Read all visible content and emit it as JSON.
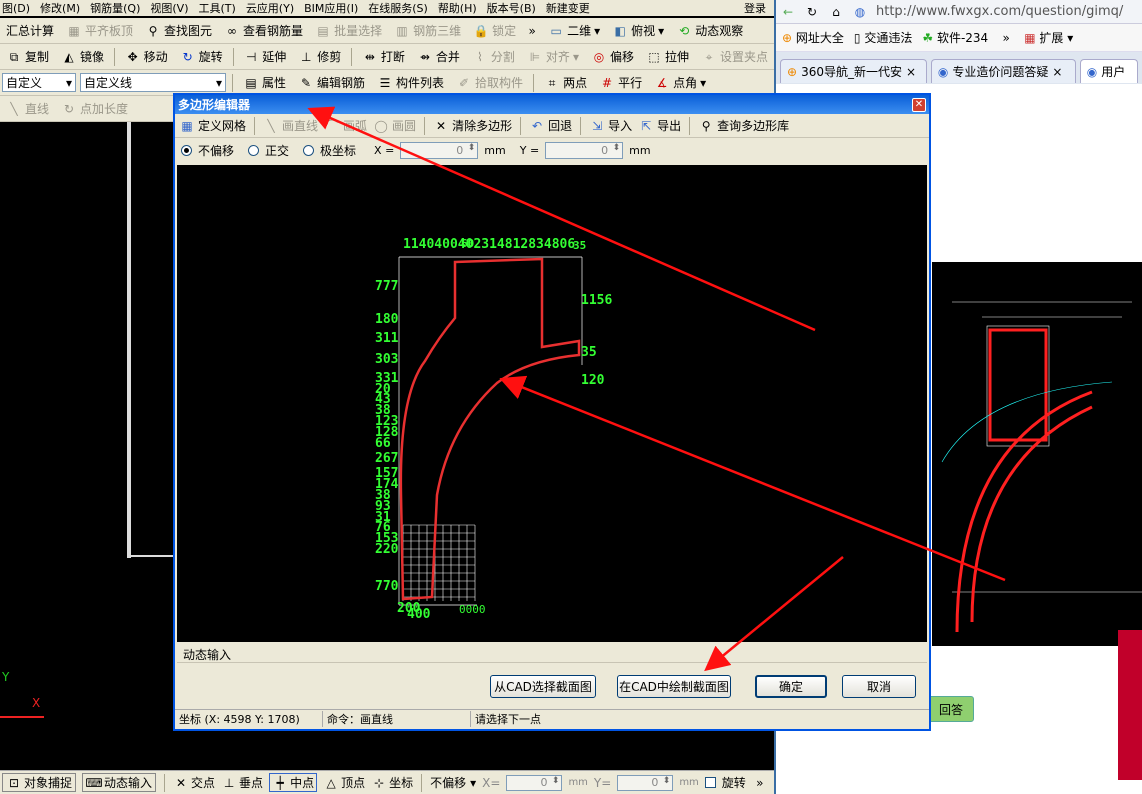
{
  "main_menu": [
    "图(D)",
    "修改(M)",
    "钢筋量(Q)",
    "视图(V)",
    "工具(T)",
    "云应用(Y)",
    "BIM应用(I)",
    "在线服务(S)",
    "帮助(H)",
    "版本号(B)",
    "新建变更"
  ],
  "login": "登录",
  "toolbar1": {
    "items": [
      "汇总计算",
      "平齐板顶",
      "查找图元",
      "查看钢筋量",
      "批量选择",
      "钢筋三维",
      "锁定"
    ],
    "view2d": "二维",
    "view_top": "俯视",
    "dynamic_observe": "动态观察"
  },
  "toolbar2": [
    "复制",
    "镜像",
    "移动",
    "旋转",
    "延伸",
    "修剪",
    "打断",
    "合并",
    "分割",
    "对齐",
    "偏移",
    "拉伸",
    "设置夹点"
  ],
  "toolbar3": {
    "combo1": "自定义",
    "combo2": "自定义线",
    "items": [
      "属性",
      "编辑钢筋",
      "构件列表",
      "拾取构件",
      "两点",
      "平行",
      "点角"
    ]
  },
  "toolbar4": [
    "直线",
    "点加长度"
  ],
  "browser": {
    "url": "http://www.fwxgx.com/question/gimq/",
    "bookmarks": [
      "网址大全",
      "交通违法",
      "软件-234",
      "扩展"
    ],
    "tabs": [
      "360导航_新一代安",
      "专业造价问题答疑",
      "用户"
    ],
    "answer_btn": "回答"
  },
  "dialog": {
    "title": "多边形编辑器",
    "tools": [
      "定义网格",
      "画直线",
      "画弧",
      "画圆",
      "清除多边形",
      "回退",
      "导入",
      "导出",
      "查询多边形库"
    ],
    "radio": [
      "不偏移",
      "正交",
      "极坐标"
    ],
    "x_label": "X =",
    "y_label": "Y =",
    "x_value": "0",
    "y_value": "0",
    "unit": "mm",
    "dynamic_input": "动态输入",
    "btn_select_cad": "从CAD选择截面图",
    "btn_draw_cad": "在CAD中绘制截面图",
    "btn_ok": "确定",
    "btn_cancel": "取消",
    "status_coord": "坐标 (X: 4598 Y: 1708)",
    "status_cmd": "命令：画直线",
    "status_prompt": "请选择下一点",
    "dims_top": "1140400402314812834806",
    "dims_top2": "60",
    "dims_top3": "35",
    "dim_right1": "1156",
    "dim_right2": "35",
    "dim_right3": "120",
    "dims_left": [
      "777",
      "180",
      "311",
      "303",
      "331",
      "20",
      "43",
      "38",
      "123",
      "128",
      "66",
      "267",
      "157",
      "174",
      "38",
      "93",
      "31",
      "76",
      "153",
      "220",
      "770"
    ],
    "dims_bottom": "200",
    "dims_bottom2": "400",
    "dims_bottom3": "0000"
  },
  "status_bar": {
    "snap": "对象捕捉",
    "dyn": "动态输入",
    "items": [
      "交点",
      "垂点",
      "中点",
      "顶点",
      "坐标"
    ],
    "offset": "不偏移",
    "x_label": "X=",
    "x_value": "0",
    "y_label": "Y=",
    "y_value": "0",
    "unit": "mm",
    "rotate": "旋转"
  },
  "axis": {
    "y": "Y",
    "x": "X"
  }
}
